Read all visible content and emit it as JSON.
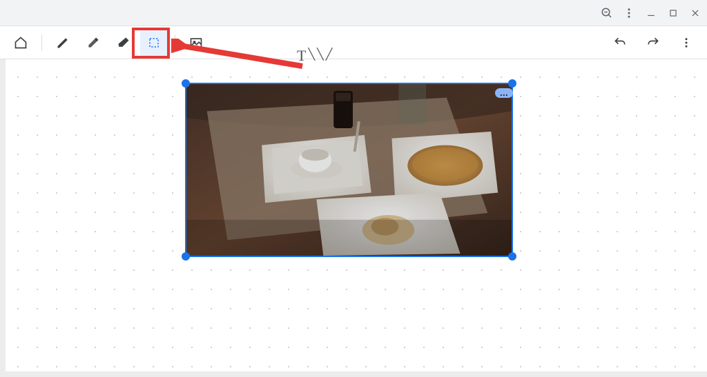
{
  "titlebar": {
    "zoom_out_icon": "zoom-out",
    "more_icon": "more-vert",
    "minimize_icon": "minimize",
    "maximize_icon": "maximize",
    "close_icon": "close"
  },
  "toolbar": {
    "home_icon": "home",
    "pen_icon": "pen",
    "highlighter_icon": "highlighter",
    "eraser_icon": "eraser",
    "select_icon": "select",
    "insert_image_icon": "insert-image",
    "undo_icon": "undo",
    "redo_icon": "redo",
    "overflow_icon": "more-vert",
    "selected_tool": "select"
  },
  "canvas": {
    "dot_grid": true,
    "image": {
      "selected": true,
      "handles": 4,
      "more_label": "...",
      "description": "Photograph of a wooden dining table with white square plates containing food, a white coffee cup on a saucer, a dark drink in a glass, and utensils."
    },
    "ink_scribble_text": "T\\\\/"
  },
  "annotation": {
    "highlight_target": "select-tool",
    "arrow_color": "#e53935"
  },
  "colors": {
    "accent": "#1a73e8",
    "annotation": "#e53935",
    "toolbar_icon": "#3c4043",
    "titlebar_icon": "#5f6368"
  }
}
